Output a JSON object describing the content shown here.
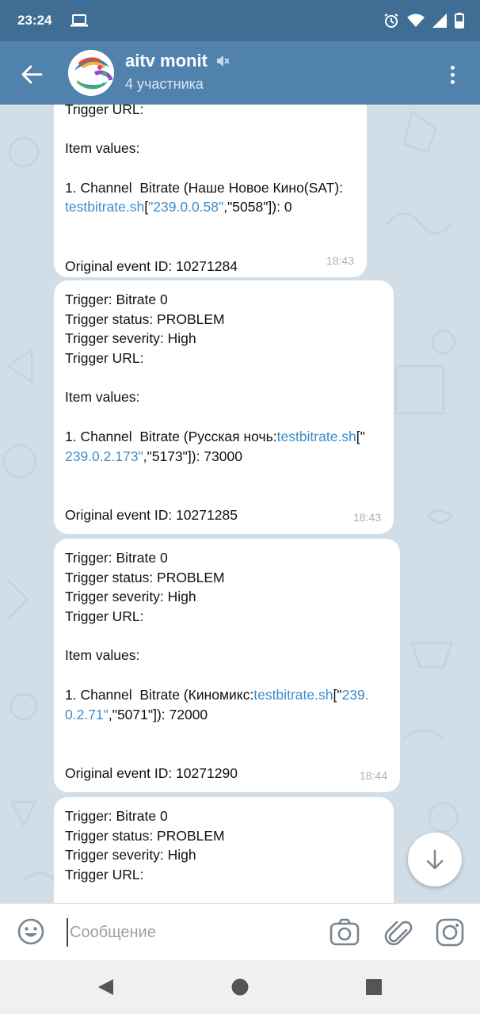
{
  "status_bar": {
    "time": "23:24"
  },
  "header": {
    "title": "aitv monit",
    "subtitle": "4 участника"
  },
  "messages": [
    {
      "lines": [
        [
          {
            "t": "Trigger URL:"
          }
        ],
        [],
        [
          {
            "t": "Item values:"
          }
        ],
        [],
        [
          {
            "t": "1. Channel  Bitrate (Наше Новое Кино(SAT):"
          }
        ],
        [
          {
            "t": "testbitrate.sh",
            "link": true
          },
          {
            "t": "["
          },
          {
            "t": "\"239.0.0.58\"",
            "link": true
          },
          {
            "t": ",\"5058\"]): 0"
          }
        ],
        [],
        [],
        [
          {
            "t": "Original event ID: 10271284"
          }
        ]
      ],
      "time": "18:43"
    },
    {
      "lines": [
        [
          {
            "t": "Trigger: Bitrate 0"
          }
        ],
        [
          {
            "t": "Trigger status: PROBLEM"
          }
        ],
        [
          {
            "t": "Trigger severity: High"
          }
        ],
        [
          {
            "t": "Trigger URL:"
          }
        ],
        [],
        [
          {
            "t": "Item values:"
          }
        ],
        [],
        [
          {
            "t": "1. Channel  Bitrate (Русская ночь:"
          },
          {
            "t": "testbitrate.sh",
            "link": true
          },
          {
            "t": "[\""
          }
        ],
        [
          {
            "t": "239.0.2.173\"",
            "link": true
          },
          {
            "t": ",\"5173\"]): 73000"
          }
        ],
        [],
        [],
        [
          {
            "t": "Original event ID: 10271285"
          }
        ]
      ],
      "time": "18:43"
    },
    {
      "lines": [
        [
          {
            "t": "Trigger: Bitrate 0"
          }
        ],
        [
          {
            "t": "Trigger status: PROBLEM"
          }
        ],
        [
          {
            "t": "Trigger severity: High"
          }
        ],
        [
          {
            "t": "Trigger URL:"
          }
        ],
        [],
        [
          {
            "t": "Item values:"
          }
        ],
        [],
        [
          {
            "t": "1. Channel  Bitrate (Киномикс:"
          },
          {
            "t": "testbitrate.sh",
            "link": true
          },
          {
            "t": "[\""
          },
          {
            "t": "239.",
            "link": true
          }
        ],
        [
          {
            "t": "0.2.71\"",
            "link": true
          },
          {
            "t": ",\"5071\"]): 72000"
          }
        ],
        [],
        [],
        [
          {
            "t": "Original event ID: 10271290"
          }
        ]
      ],
      "time": "18:44"
    },
    {
      "lines": [
        [
          {
            "t": "Trigger: Bitrate 0"
          }
        ],
        [
          {
            "t": "Trigger status: PROBLEM"
          }
        ],
        [
          {
            "t": "Trigger severity: High"
          }
        ],
        [
          {
            "t": "Trigger URL:"
          }
        ]
      ],
      "time": ""
    }
  ],
  "composer": {
    "placeholder": "Сообщение"
  },
  "icons": {
    "status_left": [
      "laptop-icon"
    ],
    "status_right": [
      "alarm-icon",
      "wifi-icon",
      "signal-icon",
      "battery-icon"
    ],
    "header": [
      "back-arrow-icon",
      "avatar",
      "mute-icon",
      "more-vert-icon"
    ],
    "composer": [
      "emoji-icon",
      "camera-icon",
      "attach-icon",
      "instagram-icon"
    ],
    "nav": [
      "back-triangle-icon",
      "home-circle-icon",
      "recents-square-icon"
    ]
  },
  "colors": {
    "status_bar": "#3f6d94",
    "app_bar": "#5082ad",
    "chat_bg": "#d1dee8",
    "link": "#3d8cc7",
    "bubble": "#ffffff",
    "time_text": "#a7b3bc"
  }
}
